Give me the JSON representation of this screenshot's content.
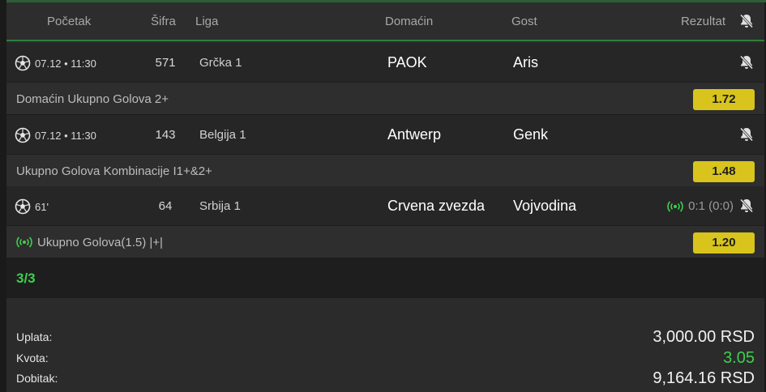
{
  "header": {
    "pocetak": "Početak",
    "sifra": "Šifra",
    "liga": "Liga",
    "domacin": "Domaćin",
    "gost": "Gost",
    "rezultat": "Rezultat",
    "bell_icon": "bell-off-icon"
  },
  "matches": [
    {
      "time": "07.12 • 11:30",
      "code": "571",
      "league": "Grčka 1",
      "home": "PAOK",
      "away": "Aris",
      "score": "",
      "live": false,
      "selection": "Domaćin Ukupno Golova  2+",
      "odd": "1.72"
    },
    {
      "time": "07.12 • 11:30",
      "code": "143",
      "league": "Belgija 1",
      "home": "Antwerp",
      "away": "Genk",
      "score": "",
      "live": false,
      "selection": "Ukupno Golova Kombinacije I1+&2+",
      "odd": "1.48"
    },
    {
      "time": "61'",
      "code": "64",
      "league": "Srbija 1",
      "home": "Crvena zvezda",
      "away": "Vojvodina",
      "score": "0:1 (0:0)",
      "live": true,
      "selection": "Ukupno Golova(1.5) |+|",
      "odd": "1.20"
    }
  ],
  "ticket": {
    "count": "3/3",
    "uplata_label": "Uplata:",
    "uplata_value": "3,000.00 RSD",
    "kvota_label": "Kvota:",
    "kvota_value": "3.05",
    "dobitak_label": "Dobitak:",
    "dobitak_value": "9,164.16 RSD"
  },
  "colors": {
    "accent_green": "#3ecf4f",
    "odd_yellow": "#d8c41c",
    "header_line": "#2f7d3c"
  }
}
